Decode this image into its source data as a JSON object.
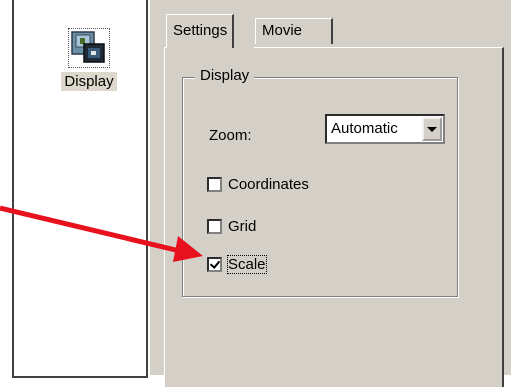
{
  "categories": [
    {
      "label": "Display",
      "icon": "display-settings-icon",
      "selected": true
    }
  ],
  "tabs": [
    {
      "label": "Settings",
      "active": true
    },
    {
      "label": "Movie",
      "active": false
    }
  ],
  "display_group": {
    "legend": "Display",
    "zoom": {
      "label": "Zoom:",
      "value": "Automatic"
    },
    "options": [
      {
        "label": "Coordinates",
        "checked": false
      },
      {
        "label": "Grid",
        "checked": false
      },
      {
        "label": "Scale",
        "checked": true,
        "focused": true
      }
    ]
  },
  "annotation": {
    "color": "#e8121e"
  },
  "colors": {
    "dialog_face": "#d4d0c8",
    "selection_bg": "#ddd8cc"
  }
}
